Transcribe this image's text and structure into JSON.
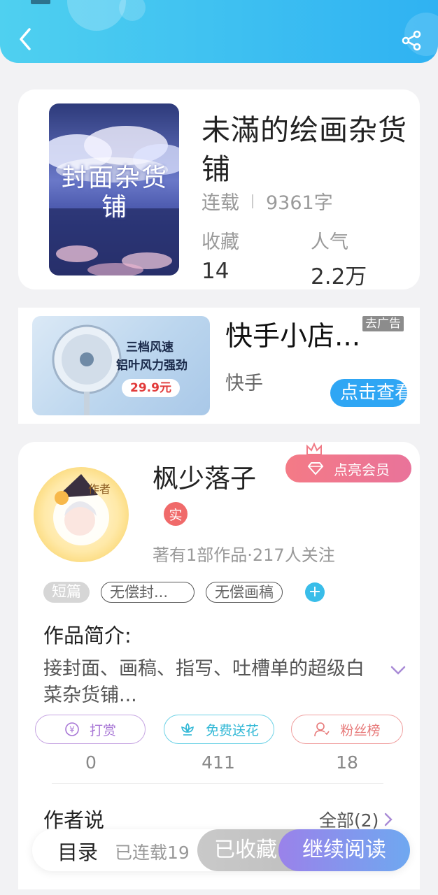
{
  "header": {
    "back_icon": "chevron-left-icon",
    "share_icon": "share-icon"
  },
  "book": {
    "title": "未滿的绘画杂货铺",
    "status": "连载",
    "word_count": "9361字",
    "favorites_label": "收藏",
    "favorites_value": "14",
    "popularity_label": "人气",
    "popularity_value": "2.2万",
    "cover_text": "封面杂货铺"
  },
  "ad": {
    "title": "快手小店...",
    "source": "快手",
    "close_label": "去广告",
    "cta_label": "点击查看",
    "image_lines": [
      "三档风速",
      "铝叶风力强劲"
    ],
    "image_price": "29.9元"
  },
  "author": {
    "name": "枫少落子",
    "avatar_label": "作者",
    "vip_label": "点亮会员",
    "verified_badge": "实",
    "stats": "著有1部作品·217人关注",
    "tags": [
      "短篇",
      "无偿封...",
      "无偿画稿"
    ],
    "intro_label": "作品简介:",
    "intro_text": "接封面、画稿、指写、吐槽单的超级白菜杂货铺...",
    "actions": [
      {
        "label": "打赏",
        "count": "0",
        "icon": "yen-icon"
      },
      {
        "label": "免费送花",
        "count": "411",
        "icon": "flower-icon"
      },
      {
        "label": "粉丝榜",
        "count": "18",
        "icon": "fans-icon"
      }
    ],
    "says_label": "作者说",
    "says_all": "全部(2)"
  },
  "bottom_bar": {
    "toc_label": "目录",
    "serial_text": "已连载19",
    "favorited_label": "已收藏",
    "continue_label": "继续阅读"
  },
  "colors": {
    "header_start": "#4fd0f0",
    "header_end": "#2fb2f2",
    "vip": "#f47a86",
    "continue_start": "#9a82ea",
    "continue_end": "#6fa8f0"
  }
}
